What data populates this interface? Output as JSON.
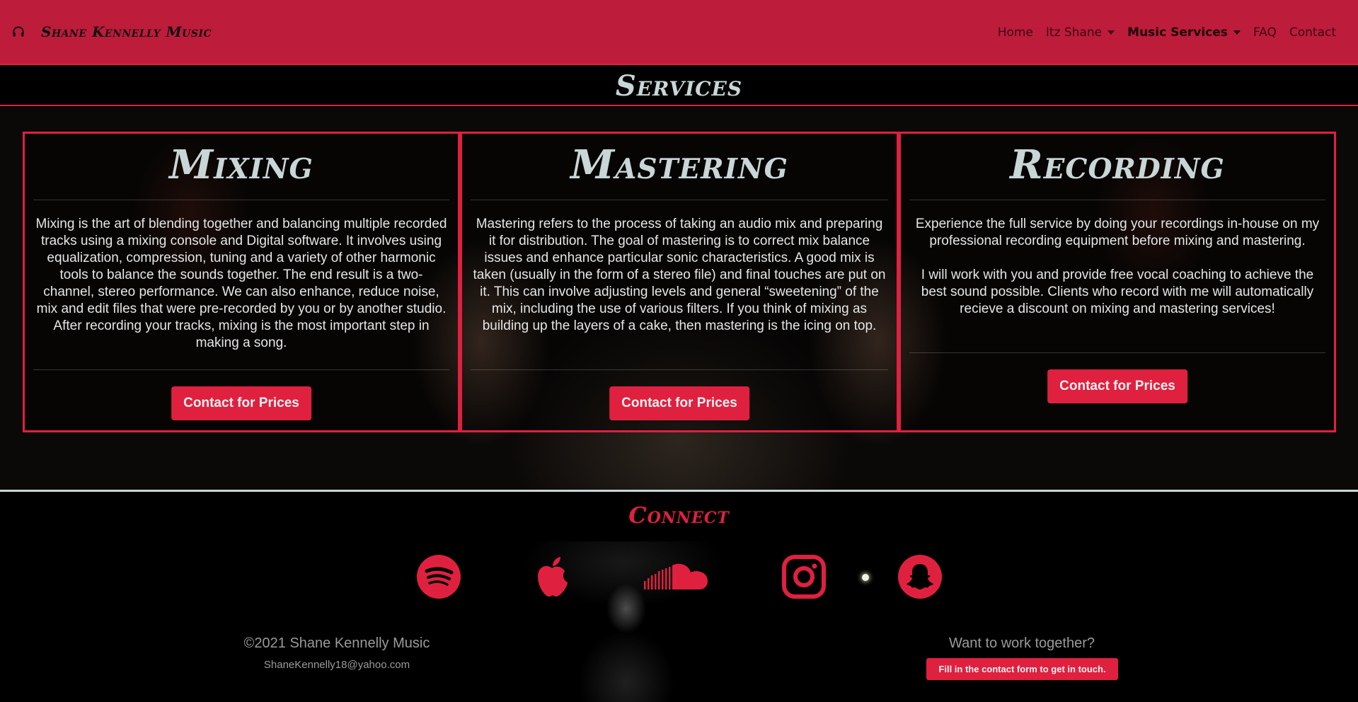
{
  "brand": {
    "name": "Shane Kennelly Music",
    "icon": "headphones-icon"
  },
  "nav": {
    "items": [
      {
        "label": "Home"
      },
      {
        "label": "Itz Shane"
      },
      {
        "label": "Music Services"
      },
      {
        "label": "FAQ"
      },
      {
        "label": "Contact"
      }
    ]
  },
  "section": {
    "title": "Services"
  },
  "services": [
    {
      "title": "Mixing",
      "body": [
        "Mixing is the art of blending together and balancing multiple recorded tracks using a mixing console and Digital software. It involves using equalization, compression, tuning and a variety of other harmonic tools to balance the sounds together. The end result is a two-channel, stereo performance. We can also enhance, reduce noise, mix and edit files that were pre-recorded by you or by another studio. After recording your tracks, mixing is the most important step in making a song."
      ],
      "button": "Contact for Prices"
    },
    {
      "title": "Mastering",
      "body": [
        "Mastering refers to the process of taking an audio mix and preparing it for distribution. The goal of mastering is to correct mix balance issues and enhance particular sonic characteristics. A good mix is taken (usually in the form of a stereo file) and final touches are put on it. This can involve adjusting levels and general “sweetening” of the mix, including the use of various filters. If you think of mixing as building up the layers of a cake, then mastering is the icing on top."
      ],
      "button": "Contact for Prices"
    },
    {
      "title": "Recording",
      "body": [
        "Experience the full service by doing your recordings in-house on my professional recording equipment before mixing and mastering.",
        "I will work with you and provide free vocal coaching to achieve the best sound possible. Clients who record with me will automatically recieve a discount on mixing and mastering services!"
      ],
      "button": "Contact for Prices"
    }
  ],
  "footer": {
    "connect_title": "Connect",
    "social_icons": [
      "spotify-icon",
      "apple-icon",
      "soundcloud-icon",
      "instagram-icon",
      "snapchat-icon"
    ],
    "copyright": "©2021 Shane Kennelly Music",
    "email": "ShaneKennelly18@yahoo.com",
    "cta_heading": "Want to work together?",
    "cta_button": "Fill in the contact form to get in touch."
  },
  "colors": {
    "accent": "#e0203f",
    "navbar": "#bd1c3a",
    "heading": "#c9d6d6"
  }
}
